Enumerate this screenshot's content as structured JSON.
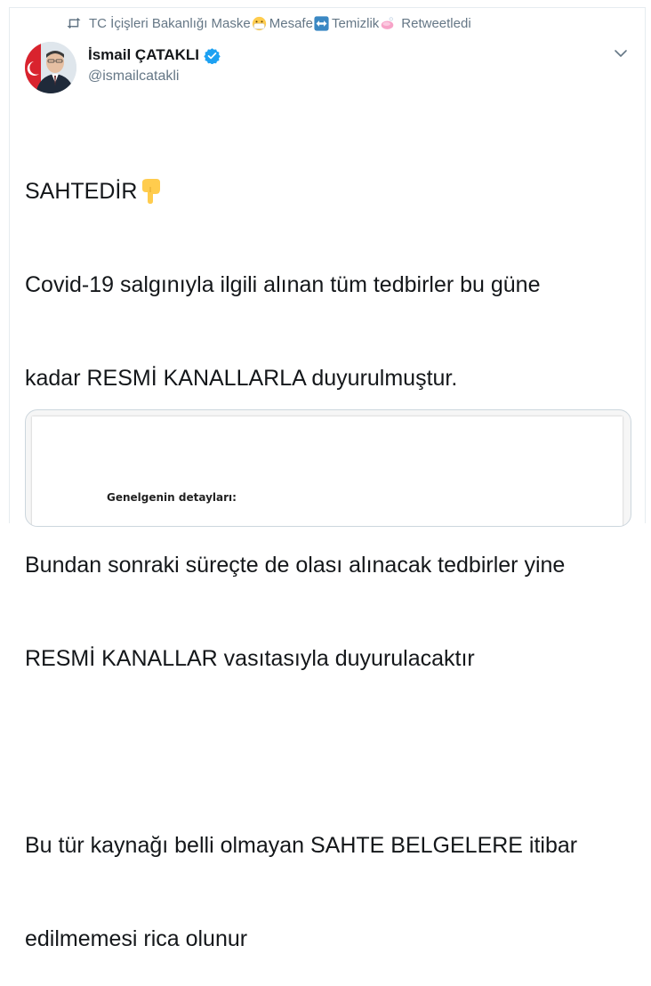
{
  "retweet": {
    "account_name": "TC İçişleri Bakanlığı Maske",
    "part2": "Mesafe",
    "part3": "Temizlik",
    "suffix": "Retweetledi",
    "icons": [
      "retweet-icon",
      "mask-face-emoji",
      "left-right-arrow-emoji",
      "soap-emoji"
    ]
  },
  "author": {
    "display_name": "İsmail ÇATAKLI",
    "handle": "@ismailcatakli",
    "verified": true
  },
  "tweet": {
    "lines": [
      "SAHTEDİR",
      "Covid-19 salgınıyla ilgili alınan tüm tedbirler bu güne",
      "kadar RESMİ KANALLARLA duyurulmuştur.",
      "",
      "Bundan sonraki süreçte de olası alınacak tedbirler yine",
      "RESMİ KANALLAR vasıtasıyla duyurulacaktır",
      "",
      "Bu tür kaynağı belli olmayan  SAHTE BELGELERE itibar",
      "edilmemesi rica olunur"
    ],
    "emoji_after_first_line": "backhand-index-pointing-down-emoji"
  },
  "media": {
    "document_heading": "Genelgenin detayları:"
  },
  "colors": {
    "text": "#14171a",
    "secondary": "#657786",
    "verified_blue": "#1da1f2",
    "border": "#e6ecf0"
  }
}
